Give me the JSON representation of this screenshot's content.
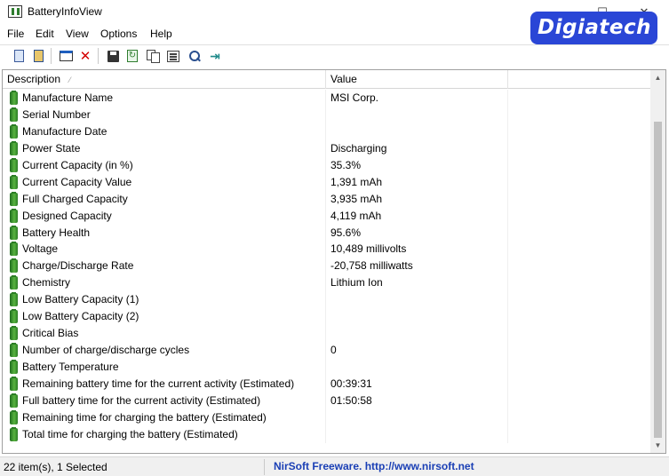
{
  "window": {
    "title": "BatteryInfoView",
    "controls": {
      "minimize": "—",
      "maximize": "☐",
      "close": "✕"
    }
  },
  "logo": {
    "text": "Digiatech"
  },
  "menu": [
    "File",
    "Edit",
    "View",
    "Options",
    "Help"
  ],
  "toolbar": {
    "buttons": [
      "battery-info-mode-icon",
      "battery-log-mode-icon",
      "html-report-icon",
      "clear-log-icon",
      "save-icon",
      "refresh-icon",
      "copy-icon",
      "properties-icon",
      "find-icon",
      "exit-icon"
    ]
  },
  "list": {
    "columns": [
      "Description",
      "Value"
    ],
    "sort_indicator": "⁄",
    "rows": [
      {
        "description": "Manufacture Name",
        "value": "MSI Corp."
      },
      {
        "description": "Serial Number",
        "value": ""
      },
      {
        "description": "Manufacture Date",
        "value": ""
      },
      {
        "description": "Power State",
        "value": "Discharging"
      },
      {
        "description": "Current Capacity (in %)",
        "value": "35.3%"
      },
      {
        "description": "Current Capacity Value",
        "value": "1,391 mAh"
      },
      {
        "description": "Full Charged Capacity",
        "value": "3,935 mAh"
      },
      {
        "description": "Designed Capacity",
        "value": "4,119 mAh"
      },
      {
        "description": "Battery Health",
        "value": "95.6%"
      },
      {
        "description": "Voltage",
        "value": "10,489 millivolts"
      },
      {
        "description": "Charge/Discharge Rate",
        "value": "-20,758 milliwatts"
      },
      {
        "description": "Chemistry",
        "value": "Lithium Ion"
      },
      {
        "description": "Low Battery Capacity (1)",
        "value": ""
      },
      {
        "description": "Low Battery Capacity (2)",
        "value": ""
      },
      {
        "description": "Critical Bias",
        "value": ""
      },
      {
        "description": "Number of charge/discharge cycles",
        "value": "0"
      },
      {
        "description": "Battery Temperature",
        "value": ""
      },
      {
        "description": "Remaining battery time for the current activity (Estimated)",
        "value": "00:39:31"
      },
      {
        "description": "Full battery time for the current activity (Estimated)",
        "value": "01:50:58"
      },
      {
        "description": "Remaining time for charging the battery (Estimated)",
        "value": ""
      },
      {
        "description": "Total  time for charging the battery (Estimated)",
        "value": ""
      }
    ]
  },
  "status": {
    "count": "22 item(s), 1 Selected",
    "link": "NirSoft Freeware.  http://www.nirsoft.net"
  },
  "colors": {
    "accent_link": "#1a3fb5",
    "logo_bg": "#2a46d6",
    "battery_icon": "#3a9a2f"
  }
}
